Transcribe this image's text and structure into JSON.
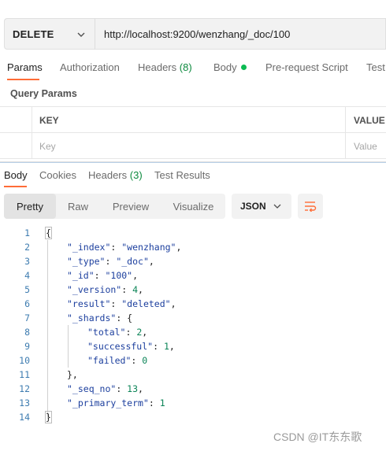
{
  "request": {
    "method": "DELETE",
    "url": "http://localhost:9200/wenzhang/_doc/100"
  },
  "request_tabs": {
    "params": "Params",
    "authorization": "Authorization",
    "headers": "Headers",
    "headers_count": "(8)",
    "body": "Body",
    "prerequest": "Pre-request Script",
    "tests": "Test"
  },
  "query_params": {
    "title": "Query Params",
    "col_key": "KEY",
    "col_value": "VALUE",
    "key_placeholder": "Key",
    "value_placeholder": "Value"
  },
  "response_tabs": {
    "body": "Body",
    "cookies": "Cookies",
    "headers": "Headers",
    "headers_count": "(3)",
    "test_results": "Test Results"
  },
  "view_modes": {
    "pretty": "Pretty",
    "raw": "Raw",
    "preview": "Preview",
    "visualize": "Visualize",
    "format": "JSON"
  },
  "response_body": {
    "line_numbers": [
      "1",
      "2",
      "3",
      "4",
      "5",
      "6",
      "7",
      "8",
      "9",
      "10",
      "11",
      "12",
      "13",
      "14"
    ],
    "index_key": "\"_index\"",
    "index_val": "\"wenzhang\"",
    "type_key": "\"_type\"",
    "type_val": "\"_doc\"",
    "id_key": "\"_id\"",
    "id_val": "\"100\"",
    "version_key": "\"_version\"",
    "version_val": "4",
    "result_key": "\"result\"",
    "result_val": "\"deleted\"",
    "shards_key": "\"_shards\"",
    "total_key": "\"total\"",
    "total_val": "2",
    "successful_key": "\"successful\"",
    "successful_val": "1",
    "failed_key": "\"failed\"",
    "failed_val": "0",
    "seq_key": "\"_seq_no\"",
    "seq_val": "13",
    "primary_key": "\"_primary_term\"",
    "primary_val": "1"
  },
  "watermark": "CSDN @IT东东歌",
  "colors": {
    "accent": "#ff6c37",
    "success": "#0cbb52",
    "json_key": "#1c3f9e",
    "json_number": "#0b8457"
  }
}
